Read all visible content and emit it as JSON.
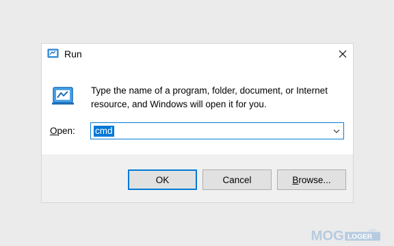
{
  "dialog": {
    "title": "Run",
    "description": "Type the name of a program, folder, document, or Internet resource, and Windows will open it for you.",
    "open_label_prefix": "O",
    "open_label_rest": "pen:",
    "input_value": "cmd",
    "buttons": {
      "ok": "OK",
      "cancel": "Cancel",
      "browse_prefix": "B",
      "browse_rest": "rowse..."
    }
  },
  "watermark": {
    "text_main": "MOG",
    "text_sub": "LOGER",
    "text_com": ".com"
  },
  "colors": {
    "accent": "#0078d7",
    "background": "#ebebeb",
    "footer": "#f0f0f0"
  },
  "icons": [
    "run-icon",
    "close-icon",
    "chevron-down-icon"
  ]
}
